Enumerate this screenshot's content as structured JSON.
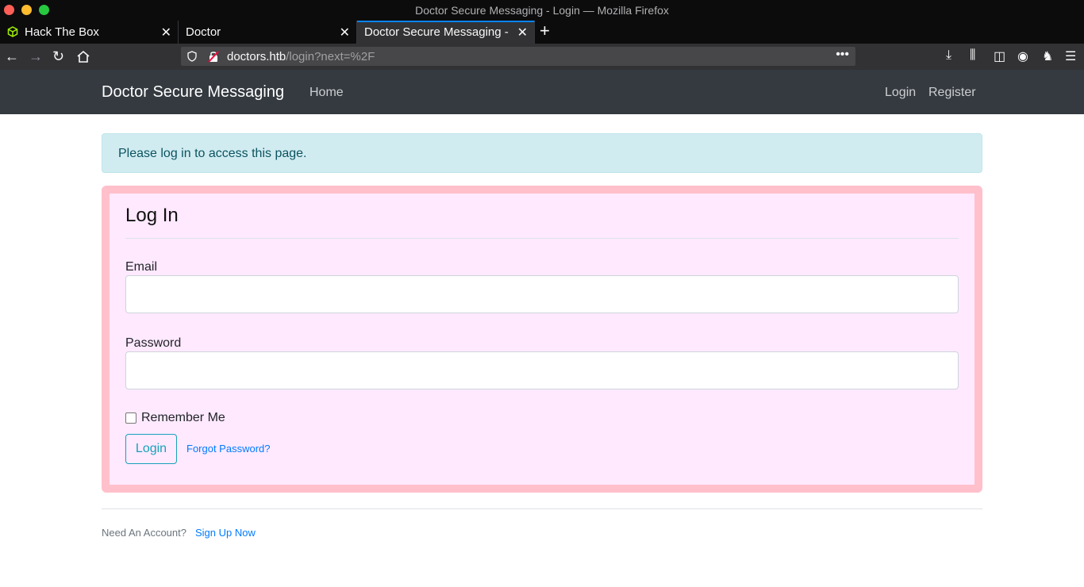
{
  "window": {
    "title": "Doctor Secure Messaging - Login — Mozilla Firefox"
  },
  "tabs": [
    {
      "label": "Hack The Box",
      "icon": "htb-cube-icon"
    },
    {
      "label": "Doctor"
    },
    {
      "label": "Doctor Secure Messaging - L"
    }
  ],
  "urlbar": {
    "host": "doctors.htb",
    "path": "/login?next=%2F"
  },
  "site": {
    "brand": "Doctor Secure Messaging",
    "nav": {
      "home": "Home",
      "login": "Login",
      "register": "Register"
    }
  },
  "alert": {
    "text": "Please log in to access this page.",
    "color": "#d1ecf1"
  },
  "form": {
    "legend": "Log In",
    "email_label": "Email",
    "password_label": "Password",
    "remember_label": "Remember Me",
    "submit_label": "Login",
    "forgot_label": "Forgot Password?",
    "card_border_color": "#ffc0cb",
    "card_bg_color": "#ffe9ff"
  },
  "footer": {
    "text": "Need An Account?",
    "link": "Sign Up Now"
  }
}
